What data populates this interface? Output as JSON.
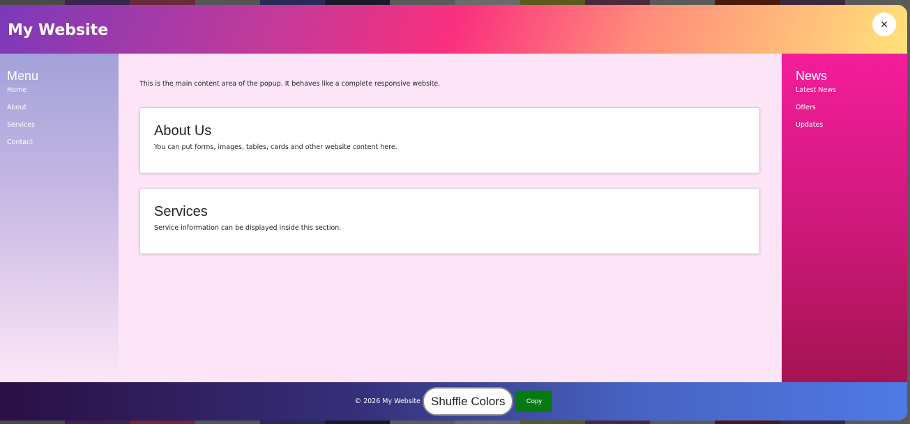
{
  "header": {
    "title": "My Website",
    "close_label": "×"
  },
  "left_sidebar": {
    "title": "Menu",
    "items": [
      "Home",
      "About",
      "Services",
      "Contact"
    ]
  },
  "right_sidebar": {
    "title": "News",
    "items": [
      "Latest News",
      "Offers",
      "Updates"
    ]
  },
  "main": {
    "intro": "This is the main content area of the popup. It behaves like a complete responsive website.",
    "cards": [
      {
        "title": "About Us",
        "text": "You can put forms, images, tables, cards and other website content here."
      },
      {
        "title": "Services",
        "text": "Service information can be displayed inside this section."
      }
    ]
  },
  "footer": {
    "copyright": "© 2026 My Website",
    "shuffle_label": "Shuffle Colors",
    "copy_label": "Copy"
  },
  "colors": {
    "background_blocks": [
      "#4a4a4a",
      "#3a2350",
      "#6a2a3a",
      "#555",
      "#2a2a5a",
      "#1a1a2a",
      "#5a5a5a",
      "#6a6a6a",
      "#5a5a1a",
      "#4a2a3a",
      "#5a5a5a",
      "#4a1a0a",
      "#3a2a3a",
      "#5a5a5a"
    ],
    "copy_button": "#067a10",
    "page_background": "#fde4f7"
  }
}
